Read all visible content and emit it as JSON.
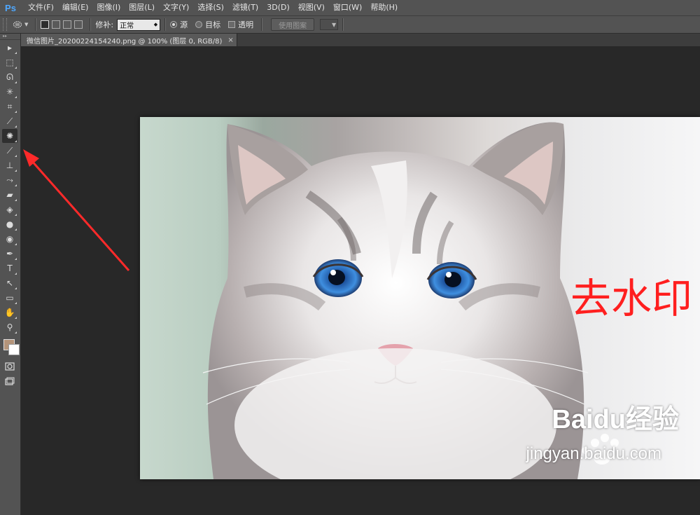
{
  "app": {
    "logo": "Ps",
    "menu": [
      "文件(F)",
      "编辑(E)",
      "图像(I)",
      "图层(L)",
      "文字(Y)",
      "选择(S)",
      "滤镜(T)",
      "3D(D)",
      "视图(V)",
      "窗口(W)",
      "帮助(H)"
    ]
  },
  "options": {
    "patch_label": "修补:",
    "patch_mode": "正常",
    "source_label": "源",
    "destination_label": "目标",
    "transparent_label": "透明",
    "use_pattern_label": "使用图案"
  },
  "document": {
    "tab_title": "微信图片_20200224154240.png @ 100% (图层 0, RGB/8)",
    "close_glyph": "×"
  },
  "tools": [
    {
      "name": "move-tool",
      "glyph": "▸",
      "icon": "move-icon"
    },
    {
      "name": "marquee-tool",
      "glyph": "⬚",
      "icon": "rectangular-marquee-icon"
    },
    {
      "name": "lasso-tool",
      "glyph": "ᘏ",
      "icon": "lasso-icon"
    },
    {
      "name": "magic-wand-tool",
      "glyph": "✳",
      "icon": "magic-wand-icon"
    },
    {
      "name": "crop-tool",
      "glyph": "⌗",
      "icon": "crop-icon"
    },
    {
      "name": "eyedropper-tool",
      "glyph": "⟋",
      "icon": "eyedropper-icon"
    },
    {
      "name": "patch-tool",
      "glyph": "✺",
      "icon": "patch-icon",
      "active": true
    },
    {
      "name": "brush-tool",
      "glyph": "⟋",
      "icon": "brush-icon"
    },
    {
      "name": "clone-stamp-tool",
      "glyph": "⊥",
      "icon": "clone-stamp-icon"
    },
    {
      "name": "history-brush-tool",
      "glyph": "⤳",
      "icon": "history-brush-icon"
    },
    {
      "name": "eraser-tool",
      "glyph": "▰",
      "icon": "eraser-icon"
    },
    {
      "name": "paint-bucket-tool",
      "glyph": "◈",
      "icon": "paint-bucket-icon"
    },
    {
      "name": "blur-tool",
      "glyph": "●",
      "icon": "blur-icon"
    },
    {
      "name": "dodge-tool",
      "glyph": "◉",
      "icon": "dodge-icon"
    },
    {
      "name": "pen-tool",
      "glyph": "✒",
      "icon": "pen-icon"
    },
    {
      "name": "type-tool",
      "glyph": "T",
      "icon": "type-icon"
    },
    {
      "name": "path-selection-tool",
      "glyph": "↖",
      "icon": "path-selection-icon"
    },
    {
      "name": "rectangle-tool",
      "glyph": "▭",
      "icon": "rectangle-icon"
    },
    {
      "name": "hand-tool",
      "glyph": "✋",
      "icon": "hand-icon"
    },
    {
      "name": "zoom-tool",
      "glyph": "⚲",
      "icon": "zoom-icon"
    }
  ],
  "colors": {
    "foreground": "#b4947a",
    "background": "#ffffff",
    "arrow": "#ff2a2a",
    "watermark": "#ff1f1f"
  },
  "canvas": {
    "watermark_text": "去水印",
    "footer_logo": "Baidu经验",
    "footer_url": "jingyan.baidu.com"
  }
}
